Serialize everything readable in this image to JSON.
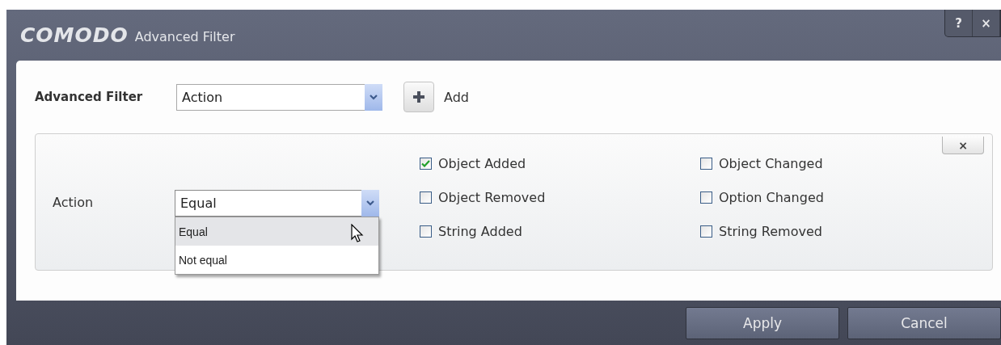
{
  "window": {
    "logo": "COMODO",
    "title": "Advanced Filter",
    "controls": [
      {
        "kind": "help",
        "label": "?"
      },
      {
        "kind": "close",
        "label": "×"
      }
    ]
  },
  "filter_bar": {
    "label": "Advanced Filter",
    "dropdown_value": "Action",
    "add_label": "Add"
  },
  "filter_card": {
    "label": "Action",
    "operator": {
      "value": "Equal",
      "expanded": true,
      "options": [
        {
          "label": "Equal",
          "selected": true
        },
        {
          "label": "Not equal",
          "selected": false
        }
      ]
    },
    "checkboxes": [
      {
        "label": "Object Added",
        "checked": true
      },
      {
        "label": "Object Changed",
        "checked": false
      },
      {
        "label": "Object Removed",
        "checked": false
      },
      {
        "label": "Option Changed",
        "checked": false
      },
      {
        "label": "String Added",
        "checked": false
      },
      {
        "label": "String Removed",
        "checked": false
      }
    ]
  },
  "buttons": [
    "Apply",
    "Cancel"
  ]
}
